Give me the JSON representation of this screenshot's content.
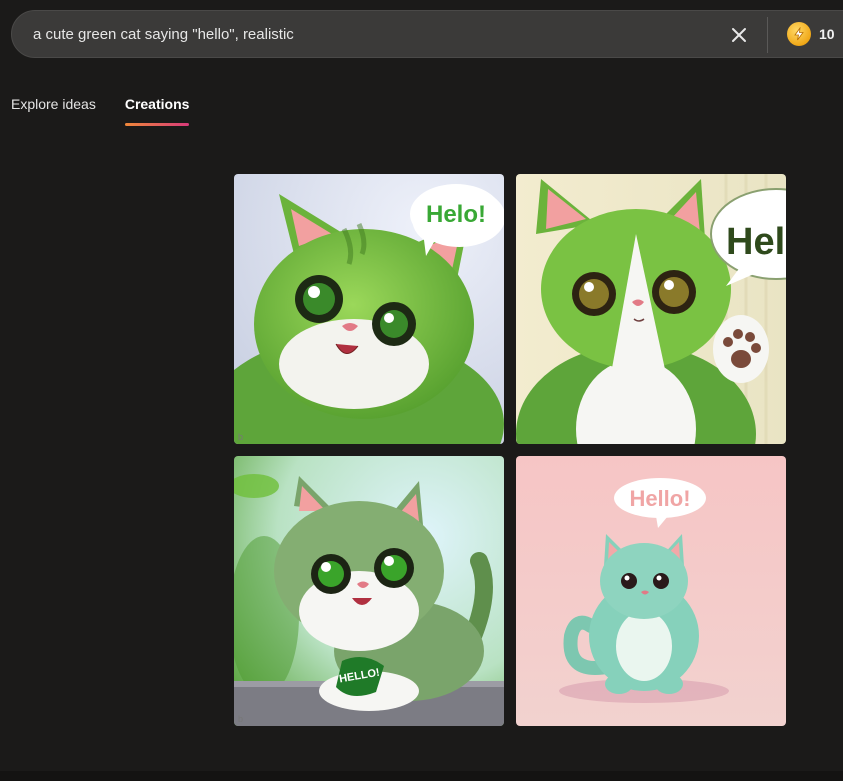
{
  "search": {
    "query": "a cute green cat saying \"hello\", realistic",
    "clear_icon": "close-icon"
  },
  "rewards": {
    "icon": "lightning-coin-icon",
    "count": "10",
    "accent": "#f5b21f"
  },
  "tabs": [
    {
      "label": "Explore ideas",
      "active": false
    },
    {
      "label": "Creations",
      "active": true
    }
  ],
  "tab_underline_colors": [
    "#f0883a",
    "#d83a7a"
  ],
  "images": [
    {
      "bubble_text": "Helo!"
    },
    {
      "bubble_text": "Hello"
    },
    {
      "bubble_text": "HELLO!"
    },
    {
      "bubble_text": "Hello!"
    }
  ]
}
